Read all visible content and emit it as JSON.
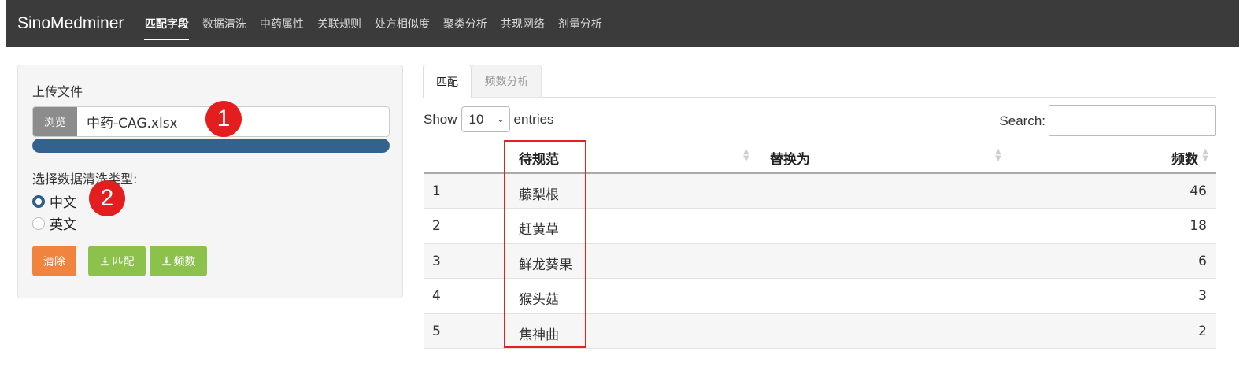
{
  "navbar": {
    "brand": "SinoMedminer",
    "items": [
      {
        "label": "匹配字段",
        "active": true
      },
      {
        "label": "数据清洗"
      },
      {
        "label": "中药属性"
      },
      {
        "label": "关联规则"
      },
      {
        "label": "处方相似度"
      },
      {
        "label": "聚类分析"
      },
      {
        "label": "共现网络"
      },
      {
        "label": "剂量分析"
      }
    ]
  },
  "sidebar": {
    "upload_label": "上传文件",
    "browse_label": "浏览",
    "file_name": "中药-CAG.xlsx",
    "upload_progress": 1.0,
    "clean_type_label": "选择数据清洗类型:",
    "radio_options": [
      {
        "label": "中文",
        "checked": true
      },
      {
        "label": "英文",
        "checked": false
      }
    ],
    "buttons": {
      "clear": "清除",
      "download_match": "匹配",
      "download_freq": "频数"
    },
    "annotations": {
      "badge1": "1",
      "badge2": "2"
    }
  },
  "tabs": [
    {
      "label": "匹配",
      "active": true
    },
    {
      "label": "频数分析",
      "active": false
    }
  ],
  "table_controls": {
    "show_label": "Show",
    "entries_value": "10",
    "entries_label": "entries",
    "search_label": "Search:"
  },
  "table": {
    "headers": [
      "待规范",
      "替换为",
      "频数"
    ],
    "rows": [
      {
        "index": "1",
        "name": "藤梨根",
        "replace": "",
        "freq": "46"
      },
      {
        "index": "2",
        "name": "赶黄草",
        "replace": "",
        "freq": "18"
      },
      {
        "index": "3",
        "name": "鲜龙葵果",
        "replace": "",
        "freq": "6"
      },
      {
        "index": "4",
        "name": "猴头菇",
        "replace": "",
        "freq": "3"
      },
      {
        "index": "5",
        "name": "焦神曲",
        "replace": "",
        "freq": "2"
      }
    ]
  },
  "colors": {
    "navbar": "#3b3b3b",
    "progress": "#34628f",
    "clear_button": "#f0843e",
    "download_button": "#8cc14c",
    "annotation": "#e41e1e"
  }
}
